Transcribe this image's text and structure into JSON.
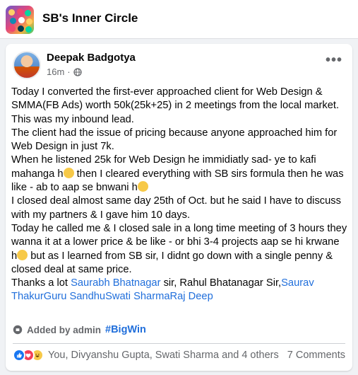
{
  "group": {
    "title": "SB's Inner Circle"
  },
  "post": {
    "author": "Deepak Badgotya",
    "time": "16m",
    "time_sep": "·",
    "body": {
      "line1": "Today I converted the first-ever approached client for Web Design & SMMA(FB Ads) worth 50k(25k+25) in 2 meetings from the local market.",
      "line2": "This was my inbound lead.",
      "line3": "The client had the issue of pricing because anyone approached him for Web Design in just 7k.",
      "line4a": "When he listened 25k for Web Design he immidiatly sad- ye to kafi mahanga h",
      "line4b": " then I cleared everything with SB sirs formula then he was like - ab to aap se bnwani h",
      "line5": "I closed deal almost same day 25th of Oct. but he said I have to discuss with my partners & I gave him 10 days.",
      "line6a": "Today he called me & I closed sale in a long time meeting of 3 hours they wanna it at a lower price & be like - or bhi 3-4 projects aap se hi krwane h",
      "line6b": " but as I learned from SB sir, I didnt go down with a single penny & closed deal at same price.",
      "thanks_prefix": "Thanks a lot ",
      "mention1": "Saurabh Bhatnagar",
      "thanks_mid": " sir, Rahul Bhatanagar Sir,",
      "mention2": "Saurav ThakurGuru SandhuSwati SharmaRaj Deep"
    },
    "added_by": "Added by admin",
    "hashtag": "#BigWin",
    "reactors": "You, Divyanshu Gupta, Swati Sharma and 4 others",
    "comments": "7 Comments"
  },
  "icons": {
    "more": "more-options-icon",
    "privacy": "globe-icon",
    "added": "tag-icon",
    "reactions": [
      "like-icon",
      "love-icon",
      "haha-icon"
    ]
  },
  "colors": {
    "link": "#216fdb",
    "muted": "#65676b",
    "like": "#1877f2",
    "love": "#f33e58",
    "haha": "#f7c948"
  }
}
